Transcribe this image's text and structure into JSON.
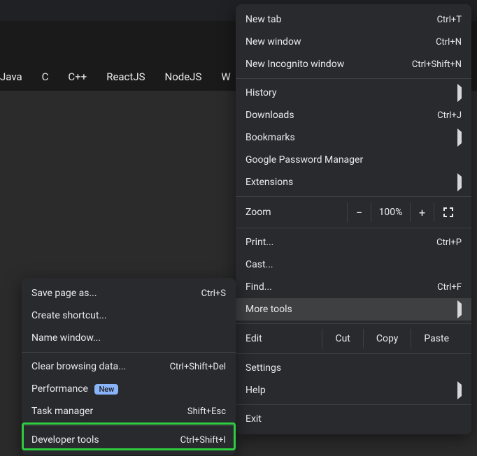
{
  "nav": {
    "items": [
      "Java",
      "C",
      "C++",
      "ReactJS",
      "NodeJS",
      "W"
    ]
  },
  "heading_fragment": "",
  "mainMenu": {
    "new_tab": "New tab",
    "new_tab_sc": "Ctrl+T",
    "new_window": "New window",
    "new_window_sc": "Ctrl+N",
    "incognito": "New Incognito window",
    "incognito_sc": "Ctrl+Shift+N",
    "history": "History",
    "downloads": "Downloads",
    "downloads_sc": "Ctrl+J",
    "bookmarks": "Bookmarks",
    "gpm": "Google Password Manager",
    "extensions": "Extensions",
    "zoom": "Zoom",
    "zoom_minus": "−",
    "zoom_pct": "100%",
    "zoom_plus": "+",
    "print": "Print...",
    "print_sc": "Ctrl+P",
    "cast": "Cast...",
    "find": "Find...",
    "find_sc": "Ctrl+F",
    "more_tools": "More tools",
    "edit": "Edit",
    "cut": "Cut",
    "copy": "Copy",
    "paste": "Paste",
    "settings": "Settings",
    "help": "Help",
    "exit": "Exit"
  },
  "subMenu": {
    "save_page": "Save page as...",
    "save_page_sc": "Ctrl+S",
    "create_shortcut": "Create shortcut...",
    "name_window": "Name window...",
    "clear_browsing": "Clear browsing data...",
    "clear_browsing_sc": "Ctrl+Shift+Del",
    "performance": "Performance",
    "perf_badge": "New",
    "task_manager": "Task manager",
    "task_manager_sc": "Shift+Esc",
    "devtools": "Developer tools",
    "devtools_sc": "Ctrl+Shift+I"
  }
}
